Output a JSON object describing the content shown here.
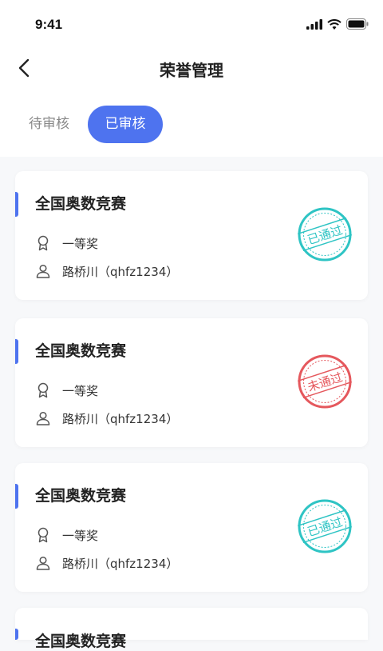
{
  "status_bar": {
    "time": "9:41"
  },
  "header": {
    "title": "荣誉管理"
  },
  "tabs": [
    {
      "label": "待审核",
      "active": false
    },
    {
      "label": "已审核",
      "active": true
    }
  ],
  "colors": {
    "accent": "#4e73ef",
    "approved": "#2ec4c4",
    "rejected": "#e5585d"
  },
  "cards": [
    {
      "title": "全国奥数竞赛",
      "award": "一等奖",
      "student": "路桥川（qhfz1234）",
      "status": "已通过"
    },
    {
      "title": "全国奥数竞赛",
      "award": "一等奖",
      "student": "路桥川（qhfz1234）",
      "status": "未通过"
    },
    {
      "title": "全国奥数竞赛",
      "award": "一等奖",
      "student": "路桥川（qhfz1234）",
      "status": "已通过"
    },
    {
      "title": "全国奥数竞赛"
    }
  ]
}
